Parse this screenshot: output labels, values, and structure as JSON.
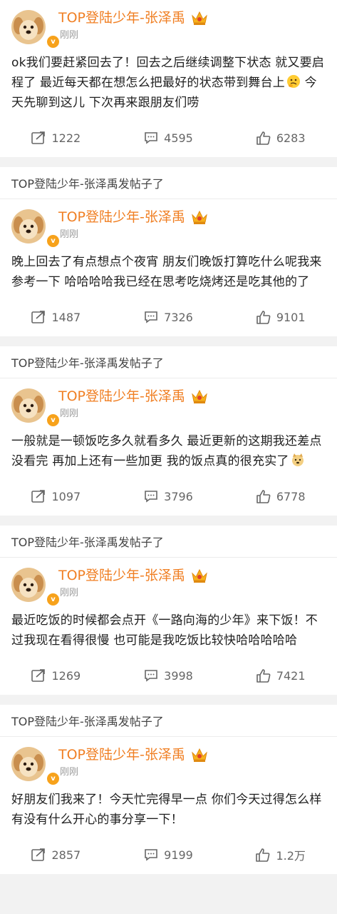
{
  "user": {
    "name": "TOP登陆少年-张泽禹",
    "time": "刚刚",
    "verified_badge": "v"
  },
  "colors": {
    "username": "#f07f23",
    "badge": "#f7a21b",
    "page_bg": "#f2f2f2"
  },
  "repost_label": "TOP登陆少年-张泽禹发帖子了",
  "posts": [
    {
      "text": "ok我们要赶紧回去了！回去之后继续调整下状态 就又要启程了 最近每天都在想怎么把最好的状态带到舞台上",
      "text_after": " 今天先聊到这儿 下次再来跟朋友们唠",
      "emoji": "thinking-face",
      "reposts": "1222",
      "comments": "4595",
      "likes": "6283"
    },
    {
      "text": "晚上回去了有点想点个夜宵 朋友们晚饭打算吃什么呢我来参考一下 哈哈哈哈我已经在思考吃烧烤还是吃其他的了",
      "reposts": "1487",
      "comments": "7326",
      "likes": "9101"
    },
    {
      "text": "一般就是一顿饭吃多久就看多久 最近更新的这期我还差点没看完 再加上还有一些加更 我的饭点真的很充实了",
      "emoji": "doge-face",
      "reposts": "1097",
      "comments": "3796",
      "likes": "6778"
    },
    {
      "text": "最近吃饭的时候都会点开《一路向海的少年》来下饭！不过我现在看得很慢 也可能是我吃饭比较快哈哈哈哈哈",
      "reposts": "1269",
      "comments": "3998",
      "likes": "7421"
    },
    {
      "text": "好朋友们我来了！今天忙完得早一点 你们今天过得怎么样 有没有什么开心的事分享一下！",
      "reposts": "2857",
      "comments": "9199",
      "likes": "1.2万"
    }
  ],
  "icons": {
    "repost": "share-icon",
    "comment": "comment-icon",
    "like": "thumbs-up-icon",
    "crown": "crown-badge-icon"
  }
}
